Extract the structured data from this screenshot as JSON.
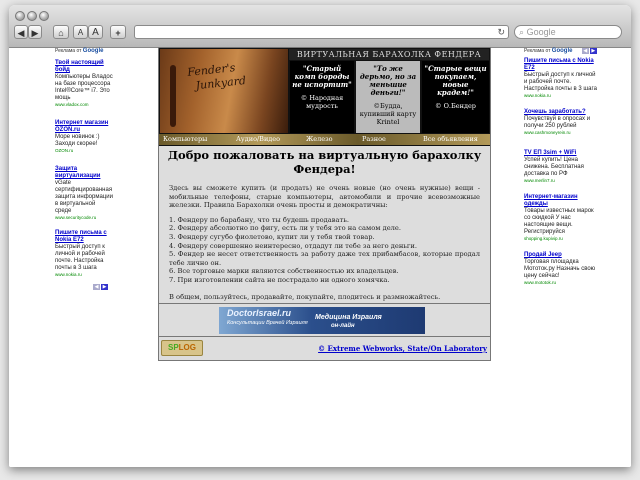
{
  "browser": {
    "search_placeholder": "Google",
    "reload_icon": "↻",
    "back_icon": "◀",
    "forward_icon": "▶",
    "home_icon": "⌂",
    "text_smaller": "A",
    "text_bigger": "A",
    "add_icon": "+"
  },
  "left_ads": {
    "header_label": "Реклама от",
    "header_brand": "Google",
    "items": [
      {
        "title": "Твой настоящий бойд",
        "text": "Компьютеры Владос на базе процессора Intel®Core™ i7. Это мощь",
        "url": "www.vladox.com"
      },
      {
        "title": "Интернет магазин OZON.ru",
        "text": "Море новинок :) Заходи скорее!",
        "url": "OZON.ru"
      },
      {
        "title": "Защита виртуализации",
        "text": "vGate сертифицированная защита информации в виртуальной среде",
        "url": "www.securitycode.ru"
      },
      {
        "title": "Пишите письма с Nokia E72",
        "text": "Быстрый доступ к личной и рабочей почте. Настройка почты в 3 шага",
        "url": "www.nokia.ru"
      }
    ]
  },
  "right_ads": {
    "header_label": "Реклама от",
    "header_brand": "Google",
    "items": [
      {
        "title": "Пишите письма с Nokia E72",
        "text": "Быстрый доступ к личной и рабочей почте. Настройка почты в 3 шага",
        "url": "www.nokia.ru"
      },
      {
        "title": "Хочешь заработать?",
        "text": "Почувствуй в опросах и получи 250 рублей",
        "url": "www.cashmoneyrein.ru"
      },
      {
        "title": "TV EΠ 3sim + WiFi",
        "text": "Успей купить! Цена снижена. Бесплатная доставка по РФ",
        "url": "www.merlin7.ru"
      },
      {
        "title": "Интернет-магазин одежды",
        "text": "Товары известных марок со скидкой У нас настоящие вещи. Регистрируйся",
        "url": "shopping.kupivip.ru"
      },
      {
        "title": "Продай Jeep",
        "text": "Торговая площадка Мототок.ру Назначь свою цену сейчас!",
        "url": "www.mototok.ru"
      }
    ]
  },
  "banner": {
    "photo_text_1": "Fender's",
    "photo_text_2": "Junkyard",
    "title": "ВИРТУАЛЬНАЯ БАРАХОЛКА ФЕНДЕРА",
    "quote1": "\"Старый комп бороды не испортит\"",
    "quote1_author": "© Народная мудрость",
    "quote2": "\"То же дерьмо, но за меньшие деньги!\"",
    "quote2_author": "©Будда, купивший карту Krintel",
    "quote3": "\"Старые вещи покупаем, новые крадем!\"",
    "quote3_author": "© О.Бендер"
  },
  "nav": {
    "computers": "Компьютеры",
    "audio_video": "Аудио/Видео",
    "hardware": "Железо",
    "misc": "Разное",
    "all_ads": "Все объявления"
  },
  "main": {
    "heading": "Добро пожаловать на виртуальную барахолку Фендера!",
    "intro": "Здесь вы сможете купить (и продать) не очень новые (но очень нужные) вещи - мобильные телефоны, старые компьютеры, автомобили и прочие всевозможные железки. Правила Барахолки очень просты и демократичны:",
    "rules": [
      "1. Фендеру по барабану, что ты будешь продавать.",
      "2. Фендеру абсолютно по фигу, есть ли у тебя это на самом деле.",
      "3. Фендеру сугубо фиолетово, купит ли у тебя твой товар.",
      "4. Фендеру совершенно неинтересно, отдадут ли тебе за него деньги.",
      "5. Фендер не несет ответственность за работу даже тех прибамбасов, которые продал тебе лично он.",
      "6. Все торговые марки являются собственностью их владельцев.",
      "7. При изготовлении сайта не пострадало ни одного хомячка."
    ],
    "outro": "В общем, пользуйтесь, продавайте, покупайте, плодитесь и размножайтесь."
  },
  "ad_banner": {
    "line1": "DoctorIsrael.ru",
    "line2": "Консультации Врачей Израиля",
    "line3": "Медицина Израиля",
    "line4": "он-лайн"
  },
  "footer": {
    "splog_a": "SP",
    "splog_b": "LOG",
    "credit": "© Extreme Webworks, State/On Laboratory"
  }
}
